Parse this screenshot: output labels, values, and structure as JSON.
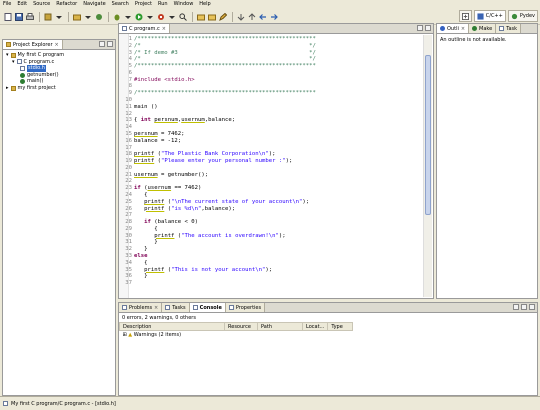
{
  "menu": [
    "File",
    "Edit",
    "Source",
    "Refactor",
    "Navigate",
    "Search",
    "Project",
    "Run",
    "Window",
    "Help"
  ],
  "perspectives": {
    "cpp": "C/C++",
    "pydev": "Pydev"
  },
  "explorer": {
    "title": "Project Explorer",
    "project1": "My first C program",
    "file": "C program.c",
    "include": "stdio.h",
    "fn1": "getnumber()",
    "fn2": "main()",
    "project2": "my first project"
  },
  "editor": {
    "tab": "C program.c",
    "lines": [
      {
        "n": "1",
        "t": "/*****************************************************"
      },
      {
        "n": "2",
        "t": "/*                                                  */"
      },
      {
        "n": "3",
        "t": "/* If demo #3                                       */"
      },
      {
        "n": "4",
        "t": "/*                                                  */"
      },
      {
        "n": "5",
        "t": "/*****************************************************"
      },
      {
        "n": "6",
        "t": ""
      },
      {
        "n": "7",
        "t": "#include <stdio.h>"
      },
      {
        "n": "8",
        "t": ""
      },
      {
        "n": "9",
        "t": "/*****************************************************"
      },
      {
        "n": "10",
        "t": ""
      },
      {
        "n": "11",
        "t": "main ()"
      },
      {
        "n": "12",
        "t": ""
      },
      {
        "n": "13",
        "t": "{ int persnum,usernum,balance;"
      },
      {
        "n": "14",
        "t": ""
      },
      {
        "n": "15",
        "t": "persnum = 7462;"
      },
      {
        "n": "16",
        "t": "balance = -12;"
      },
      {
        "n": "17",
        "t": ""
      },
      {
        "n": "18",
        "t": "printf (\"The Plastic Bank Corporation\\n\");"
      },
      {
        "n": "19",
        "t": "printf (\"Please enter your personal number :\");"
      },
      {
        "n": "20",
        "t": ""
      },
      {
        "n": "21",
        "t": "usernum = getnumber();"
      },
      {
        "n": "22",
        "t": ""
      },
      {
        "n": "23",
        "t": "if (usernum == 7462)"
      },
      {
        "n": "24",
        "t": "   {"
      },
      {
        "n": "25",
        "t": "   printf (\"\\nThe current state of your account\\n\");"
      },
      {
        "n": "26",
        "t": "   printf (\"is %d\\n\",balance);"
      },
      {
        "n": "27",
        "t": ""
      },
      {
        "n": "28",
        "t": "   if (balance < 0)"
      },
      {
        "n": "29",
        "t": "      {"
      },
      {
        "n": "30",
        "t": "      printf (\"The account is overdrawn!\\n\");"
      },
      {
        "n": "31",
        "t": "      }"
      },
      {
        "n": "32",
        "t": "   }"
      },
      {
        "n": "33",
        "t": "else"
      },
      {
        "n": "34",
        "t": "   {"
      },
      {
        "n": "35",
        "t": "   printf (\"This is not your account\\n\");"
      },
      {
        "n": "36",
        "t": "   }"
      },
      {
        "n": "37",
        "t": ""
      }
    ]
  },
  "outline": {
    "tab1": "Outli",
    "tab2": "Make",
    "tab3": "Task",
    "message": "An outline is not available."
  },
  "console": {
    "tabs": [
      "Problems",
      "Tasks",
      "Console",
      "Properties"
    ],
    "count": "0 errors, 2 warnings, 0 others",
    "columns": [
      "Description",
      "Resource",
      "Path",
      "Locat...",
      "Type"
    ],
    "row": "Warnings (2 items)"
  },
  "status": "My first C program/C program.c - [stdio.h]"
}
